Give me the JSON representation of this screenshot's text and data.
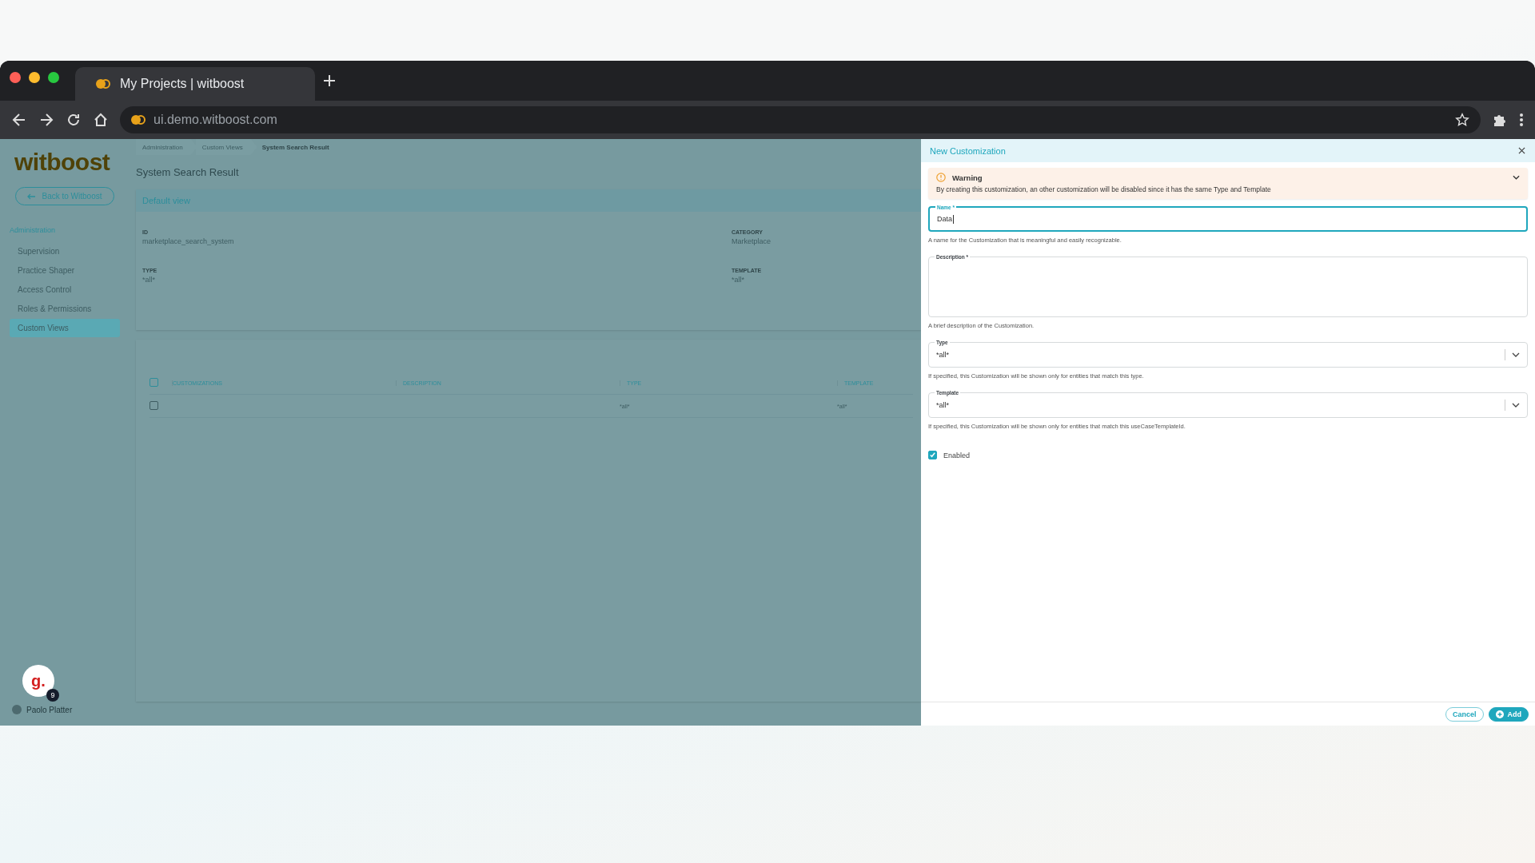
{
  "browser": {
    "tab_title": "My Projects | witboost",
    "url": "ui.demo.witboost.com"
  },
  "sidebar": {
    "logo": "witboost",
    "back_button": "Back to Witboost",
    "section": "Administration",
    "items": [
      {
        "label": "Supervision",
        "selected": false
      },
      {
        "label": "Practice Shaper",
        "selected": false
      },
      {
        "label": "Access Control",
        "selected": false
      },
      {
        "label": "Roles & Permissions",
        "selected": false
      },
      {
        "label": "Custom Views",
        "selected": true
      }
    ],
    "user": "Paolo Platter"
  },
  "chat_widget": {
    "logo": "g.",
    "badge": "9"
  },
  "breadcrumbs": [
    "Administration",
    "Custom Views",
    "System Search Result"
  ],
  "page_title": "System Search Result",
  "view_card": {
    "title": "Default view",
    "fields": [
      {
        "label": "ID",
        "value": "marketplace_search_system"
      },
      {
        "label": "CATEGORY",
        "value": "Marketplace"
      },
      {
        "label": "TYPE",
        "value": "*all*"
      },
      {
        "label": "TEMPLATE",
        "value": "*all*"
      }
    ]
  },
  "table": {
    "header_checked": false,
    "columns": [
      "CUSTOMIZATIONS",
      "DESCRIPTION",
      "TYPE",
      "TEMPLATE"
    ],
    "rows": [
      {
        "checked": false,
        "type": "*all*",
        "template": "*all*"
      }
    ]
  },
  "drawer": {
    "title": "New Customization",
    "warning": {
      "title": "Warning",
      "message": "By creating this customization, an other customization will be disabled since it has the same Type and Template"
    },
    "fields": [
      {
        "kind": "text",
        "label": "Name *",
        "value": "Data",
        "focused": true,
        "helper": "A name for the Customization that is meaningful and easily recognizable."
      },
      {
        "kind": "textarea",
        "label": "Description *",
        "focused": false,
        "helper": "A brief description of the Customization."
      },
      {
        "kind": "select",
        "label": "Type",
        "value": "*all*",
        "focused": false,
        "helper": "If specified, this Customization will be shown only for entities that match this type."
      },
      {
        "kind": "select",
        "label": "Template",
        "value": "*all*",
        "focused": false,
        "helper": "If specified, this Customization will be shown only for entities that match this useCaseTemplateId."
      }
    ],
    "enabled": {
      "label": "Enabled",
      "checked": true
    },
    "buttons": [
      {
        "kind": "outlined",
        "label": "Cancel"
      },
      {
        "kind": "primary",
        "label": "Add"
      }
    ]
  }
}
